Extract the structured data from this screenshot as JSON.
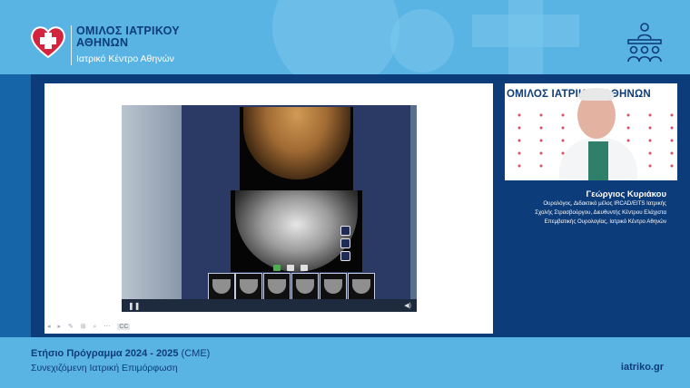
{
  "brand": {
    "title": "ΟΜΙΛΟΣ ΙΑΤΡΙΚΟΥ ΑΘΗΝΩΝ",
    "subtitle": "Ιατρικό Κέντρο Αθηνών",
    "wall_text": "ΟΜΙΛΟΣ ΙΑΤΡΙΚΟΥ ΑΘΗΝΩΝ",
    "colors": {
      "header_bg": "#5ab4e3",
      "main_bg": "#1565a8",
      "navy": "#0d3c7a",
      "heart_red": "#d2243e"
    }
  },
  "header_icon": "audience-lecture-icon",
  "video": {
    "controls": {
      "pause": "❚❚",
      "volume": "◀)"
    },
    "thumbnail_count": 6
  },
  "slide_controls": {
    "icons": "◂ ▸ ✎ ⊞ ⌕ ⋯",
    "label": "CC"
  },
  "speaker": {
    "name": "Γεώργιος Κυριάκου",
    "bio": [
      "Ουρολόγος, Διδακτικό μέλος IRCAD/EITS Ιατρικής",
      "Σχολής Στρασβούργου, Διευθυντής Κέντρου Ελάχιστα",
      "Επεμβατικής Ουρολογίας, Ιατρικό Κέντρο Αθηνών"
    ]
  },
  "footer": {
    "program": "Ετήσιο Πρόγραμμα 2024 - 2025",
    "program_tag": "(CME)",
    "subtitle": "Συνεχιζόμενη Ιατρική Επιμόρφωση",
    "url": "iatriko.gr"
  }
}
